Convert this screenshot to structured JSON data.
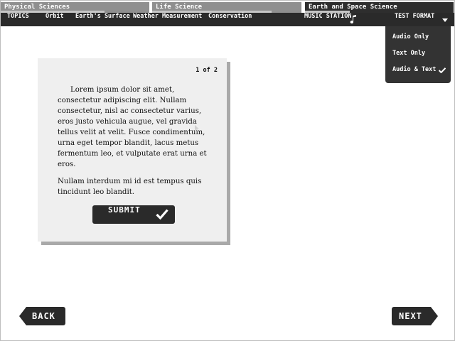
{
  "subjects": [
    {
      "label": "Physical Sciences",
      "progress": 0.7
    },
    {
      "label": "Life Science",
      "progress": 0.8
    },
    {
      "label": "Earth and Space Science",
      "progress": 0.3,
      "active": true
    }
  ],
  "topics": {
    "topics_label": "TOPICS",
    "items": [
      "Orbit",
      "Earth's Surface",
      "Weather Measurement",
      "Conservation"
    ],
    "music_station": "MUSIC STATION",
    "test_format": "TEST FORMAT"
  },
  "format_menu": {
    "options": [
      "Audio Only",
      "Text Only",
      "Audio & Text"
    ],
    "selected": "Audio & Text"
  },
  "card": {
    "page_indicator": "1 of 2",
    "paragraph_1": "Lorem ipsum dolor sit amet, consectetur adipiscing elit. Nullam consectetur, nisl ac consectetur varius, eros justo vehicula augue, vel gravida tellus velit at velit. Fusce condimentum, urna eget tempor blandit, lacus metus fermentum leo, et vulputate erat urna et eros.",
    "paragraph_2": "Nullam interdum mi id est tempus quis tincidunt leo blandit.",
    "submit_label": "SUBMIT"
  },
  "nav": {
    "back_label": "BACK",
    "next_label": "NEXT"
  },
  "icons": {
    "music": "music-note-icon",
    "format_arrow": "dropdown-arrow-icon",
    "selected_check": "check-icon",
    "submit_check": "check-icon"
  },
  "colors": {
    "bar": "#2a2a2a",
    "tab_inactive": "#8f8f8f",
    "card": "#efefef",
    "menu": "#333333"
  }
}
